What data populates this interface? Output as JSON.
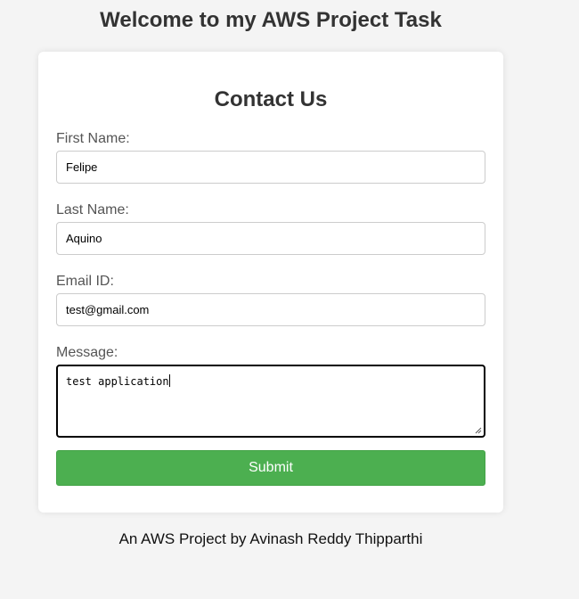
{
  "header": {
    "title": "Welcome to my AWS Project Task"
  },
  "form": {
    "title": "Contact Us",
    "first_name": {
      "label": "First Name:",
      "value": "Felipe"
    },
    "last_name": {
      "label": "Last Name:",
      "value": "Aquino"
    },
    "email": {
      "label": "Email ID:",
      "value": "test@gmail.com"
    },
    "message": {
      "label": "Message:",
      "value": "test application"
    },
    "submit_label": "Submit"
  },
  "footer": {
    "text": "An AWS Project by Avinash Reddy Thipparthi"
  },
  "colors": {
    "page_background": "#f4f4f4",
    "card_background": "#ffffff",
    "submit_button": "#4caf50",
    "input_border": "#cccccc",
    "focused_border": "#000000"
  }
}
